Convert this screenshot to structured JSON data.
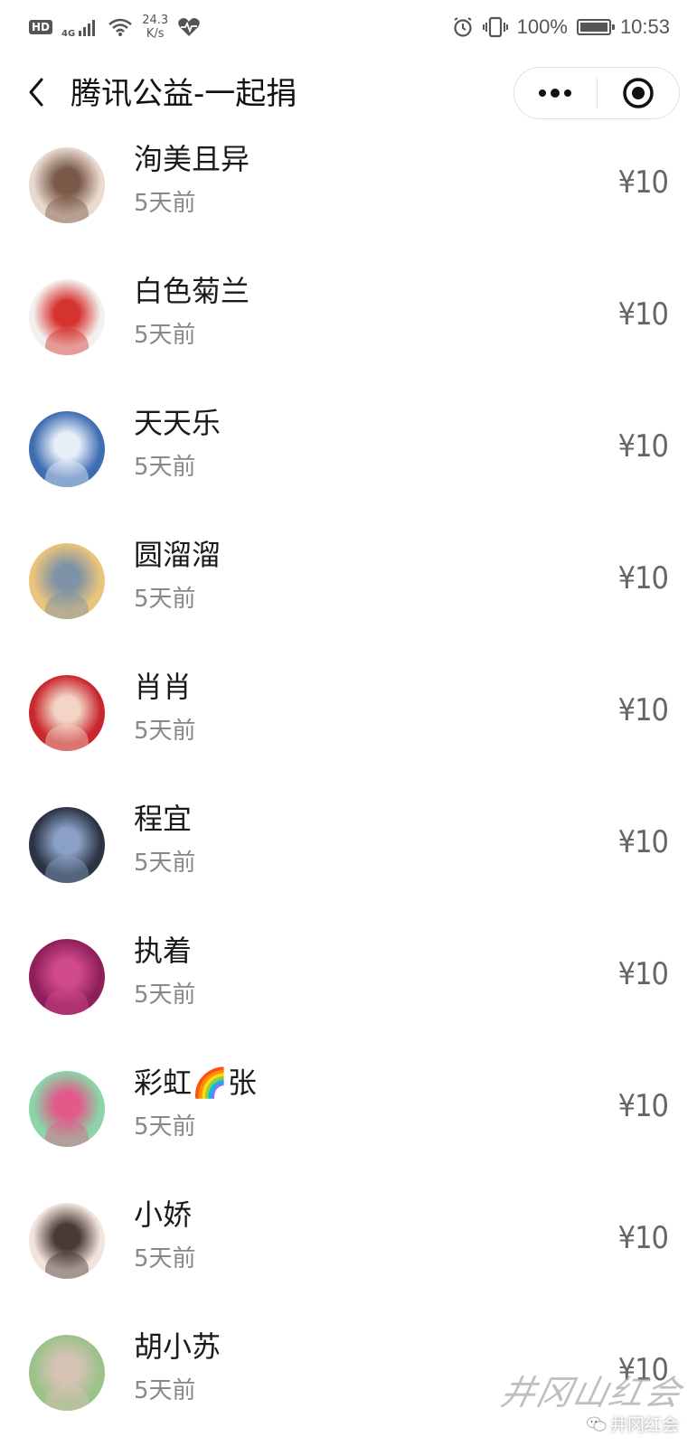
{
  "status_bar": {
    "hd": "HD",
    "network_type": "4G",
    "speed_value": "24.3",
    "speed_unit": "K/s",
    "battery_text": "100%",
    "battery_level": 1.0,
    "time": "10:53",
    "icons": [
      "signal-icon",
      "wifi-icon",
      "heartbeat-icon",
      "alarm-icon",
      "vibrate-icon",
      "battery-icon"
    ]
  },
  "nav": {
    "title": "腾讯公益-一起捐",
    "icons": [
      "back-arrow-icon",
      "more-dots-icon",
      "close-target-icon"
    ]
  },
  "donors": [
    {
      "name": "洵美且异",
      "time": "5天前",
      "amount": "¥10",
      "avatar_icon": "portrait-photo-avatar",
      "avatar_colors": [
        "#e9d9cf",
        "#7a5a48"
      ]
    },
    {
      "name": "白色菊兰",
      "time": "5天前",
      "amount": "¥10",
      "avatar_icon": "calligraphy-wang-avatar",
      "avatar_colors": [
        "#f3f0ee",
        "#d6332f"
      ]
    },
    {
      "name": "天天乐",
      "time": "5天前",
      "amount": "¥10",
      "avatar_icon": "sky-contrail-avatar",
      "avatar_colors": [
        "#3f6db1",
        "#e6eef8"
      ]
    },
    {
      "name": "圆溜溜",
      "time": "5天前",
      "amount": "¥10",
      "avatar_icon": "sunset-beach-avatar",
      "avatar_colors": [
        "#e9c47c",
        "#7f93a6"
      ]
    },
    {
      "name": "肖肖",
      "time": "5天前",
      "amount": "¥10",
      "avatar_icon": "red-mouse-plush-avatar",
      "avatar_colors": [
        "#c9262e",
        "#f2d5c4"
      ]
    },
    {
      "name": "程宜",
      "time": "5天前",
      "amount": "¥10",
      "avatar_icon": "baby-photo-avatar",
      "avatar_colors": [
        "#2b3344",
        "#8aa0c4"
      ]
    },
    {
      "name": "执着",
      "time": "5天前",
      "amount": "¥10",
      "avatar_icon": "flower-garden-avatar",
      "avatar_colors": [
        "#8e1f5a",
        "#d14a8e"
      ]
    },
    {
      "name": "彩虹🌈张",
      "time": "5天前",
      "amount": "¥10",
      "avatar_icon": "pink-flowers-vase-avatar",
      "avatar_colors": [
        "#8cd5a8",
        "#e25a8a"
      ]
    },
    {
      "name": "小娇",
      "time": "5天前",
      "amount": "¥10",
      "avatar_icon": "woman-portrait-avatar",
      "avatar_colors": [
        "#f1e4dc",
        "#4a3a34"
      ]
    },
    {
      "name": "胡小苏",
      "time": "5天前",
      "amount": "¥10",
      "avatar_icon": "garden-woman-avatar",
      "avatar_colors": [
        "#9cc28a",
        "#d6c3b4"
      ]
    }
  ],
  "watermark": {
    "script": "井冈山红会",
    "account_icon": "wechat-icon",
    "account": "井冈红会"
  },
  "colors": {
    "name_text": "#1a1a1a",
    "secondary_text": "#888888",
    "amount_text": "#666666"
  }
}
